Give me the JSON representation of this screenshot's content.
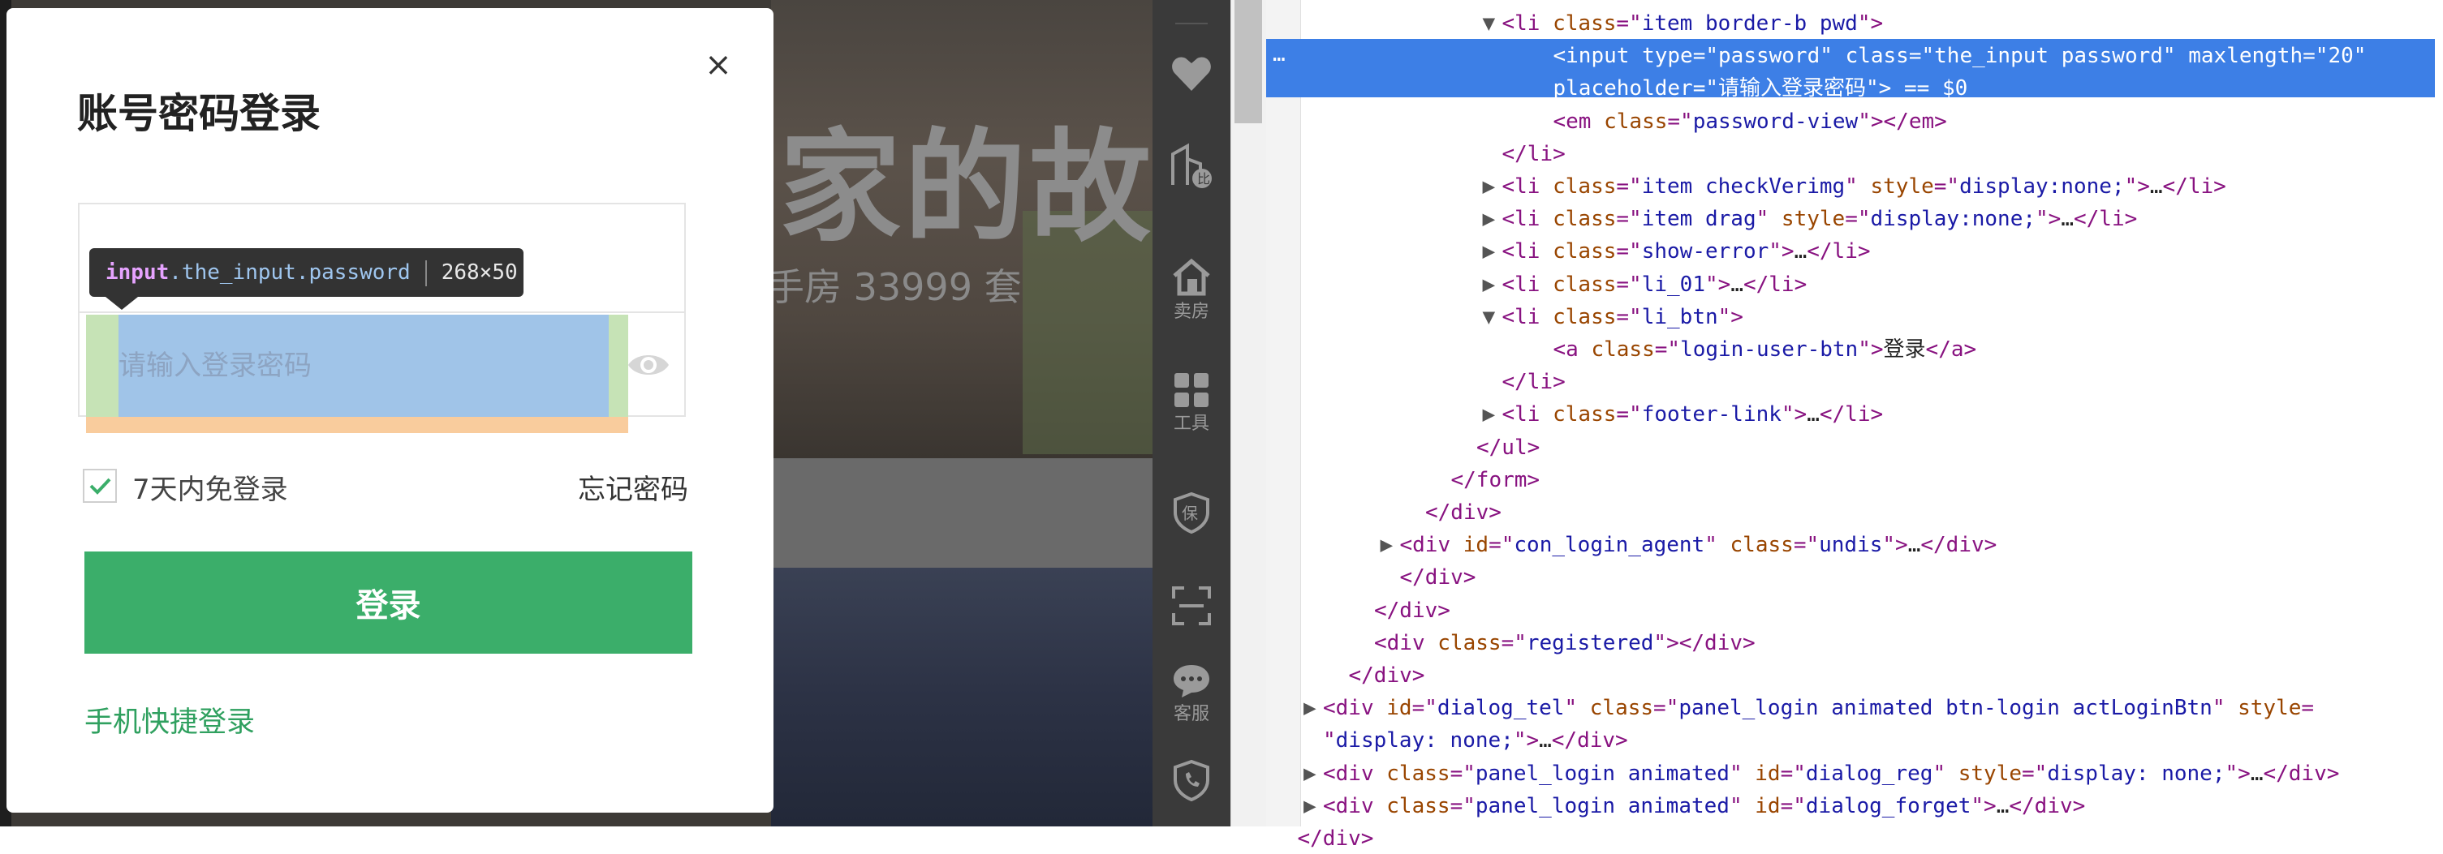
{
  "page": {
    "hero_title": "家的故事",
    "hero_subtitle": "手房 33999 套"
  },
  "toolbar": {
    "items": [
      {
        "icon": "heart-icon",
        "label": ""
      },
      {
        "icon": "building-compare-icon",
        "label": ""
      },
      {
        "icon": "house-sell-icon",
        "label": "卖房"
      },
      {
        "icon": "tools-grid-icon",
        "label": "工具"
      },
      {
        "icon": "shield-icon",
        "label": ""
      },
      {
        "icon": "scan-icon",
        "label": ""
      },
      {
        "icon": "chat-icon",
        "label": "客服"
      },
      {
        "icon": "phone-icon",
        "label": ""
      }
    ]
  },
  "dialog": {
    "title": "账号密码登录",
    "close": "×",
    "password_placeholder": "请输入登录密码",
    "remember_label": "7天内免登录",
    "remember_checked": true,
    "forgot_label": "忘记密码",
    "login_label": "登录",
    "phone_login_label": "手机快捷登录"
  },
  "inspector_tooltip": {
    "tag": "input",
    "classes": ".the_input.password",
    "size": "268×50"
  },
  "colors": {
    "primary_green": "#3bae6a",
    "link_green": "#2fa05f",
    "selection_blue": "#3d7fe6"
  },
  "devtools": {
    "lines": [
      {
        "indent": 9,
        "tri": "▼",
        "parts": [
          [
            "t",
            "<li "
          ],
          [
            "an",
            "class"
          ],
          [
            "t",
            "=\""
          ],
          [
            "av",
            "item border-b pwd"
          ],
          [
            "t",
            "\">"
          ]
        ]
      },
      {
        "indent": 11,
        "tri": "",
        "sel": true,
        "parts": [
          [
            "t",
            "<input "
          ],
          [
            "an",
            "type"
          ],
          [
            "t",
            "=\""
          ],
          [
            "av",
            "password"
          ],
          [
            "t",
            "\" "
          ],
          [
            "an",
            "class"
          ],
          [
            "t",
            "=\""
          ],
          [
            "av",
            "the_input password"
          ],
          [
            "t",
            "\" "
          ],
          [
            "an",
            "maxlength"
          ],
          [
            "t",
            "=\""
          ],
          [
            "av",
            "20"
          ],
          [
            "t",
            "\""
          ]
        ]
      },
      {
        "indent": 11,
        "tri": "",
        "sel": true,
        "parts": [
          [
            "an",
            "placeholder"
          ],
          [
            "t",
            "=\""
          ],
          [
            "av",
            "请输入登录密码"
          ],
          [
            "t",
            "\">"
          ],
          [
            "tx",
            " == $0"
          ]
        ]
      },
      {
        "indent": 11,
        "tri": "",
        "parts": [
          [
            "t",
            "<em "
          ],
          [
            "an",
            "class"
          ],
          [
            "t",
            "=\""
          ],
          [
            "av",
            "password-view"
          ],
          [
            "t",
            "\"></em>"
          ]
        ]
      },
      {
        "indent": 9,
        "tri": "",
        "parts": [
          [
            "t",
            "</li>"
          ]
        ]
      },
      {
        "indent": 9,
        "tri": "▶",
        "parts": [
          [
            "t",
            "<li "
          ],
          [
            "an",
            "class"
          ],
          [
            "t",
            "=\""
          ],
          [
            "av",
            "item checkVerimg"
          ],
          [
            "t",
            "\" "
          ],
          [
            "an",
            "style"
          ],
          [
            "t",
            "=\""
          ],
          [
            "av",
            "display:none;"
          ],
          [
            "t",
            "\">"
          ],
          [
            "tx",
            "…"
          ],
          [
            "t",
            "</li>"
          ]
        ]
      },
      {
        "indent": 9,
        "tri": "▶",
        "parts": [
          [
            "t",
            "<li "
          ],
          [
            "an",
            "class"
          ],
          [
            "t",
            "=\""
          ],
          [
            "av",
            "item drag"
          ],
          [
            "t",
            "\" "
          ],
          [
            "an",
            "style"
          ],
          [
            "t",
            "=\""
          ],
          [
            "av",
            "display:none;"
          ],
          [
            "t",
            "\">"
          ],
          [
            "tx",
            "…"
          ],
          [
            "t",
            "</li>"
          ]
        ]
      },
      {
        "indent": 9,
        "tri": "▶",
        "parts": [
          [
            "t",
            "<li "
          ],
          [
            "an",
            "class"
          ],
          [
            "t",
            "=\""
          ],
          [
            "av",
            "show-error"
          ],
          [
            "t",
            "\">"
          ],
          [
            "tx",
            "…"
          ],
          [
            "t",
            "</li>"
          ]
        ]
      },
      {
        "indent": 9,
        "tri": "▶",
        "parts": [
          [
            "t",
            "<li "
          ],
          [
            "an",
            "class"
          ],
          [
            "t",
            "=\""
          ],
          [
            "av",
            "li_01"
          ],
          [
            "t",
            "\">"
          ],
          [
            "tx",
            "…"
          ],
          [
            "t",
            "</li>"
          ]
        ]
      },
      {
        "indent": 9,
        "tri": "▼",
        "parts": [
          [
            "t",
            "<li "
          ],
          [
            "an",
            "class"
          ],
          [
            "t",
            "=\""
          ],
          [
            "av",
            "li_btn"
          ],
          [
            "t",
            "\">"
          ]
        ]
      },
      {
        "indent": 11,
        "tri": "",
        "parts": [
          [
            "t",
            "<a "
          ],
          [
            "an",
            "class"
          ],
          [
            "t",
            "=\""
          ],
          [
            "av",
            "login-user-btn"
          ],
          [
            "t",
            "\">"
          ],
          [
            "tx",
            "登录"
          ],
          [
            "t",
            "</a>"
          ]
        ]
      },
      {
        "indent": 9,
        "tri": "",
        "parts": [
          [
            "t",
            "</li>"
          ]
        ]
      },
      {
        "indent": 9,
        "tri": "▶",
        "parts": [
          [
            "t",
            "<li "
          ],
          [
            "an",
            "class"
          ],
          [
            "t",
            "=\""
          ],
          [
            "av",
            "footer-link"
          ],
          [
            "t",
            "\">"
          ],
          [
            "tx",
            "…"
          ],
          [
            "t",
            "</li>"
          ]
        ]
      },
      {
        "indent": 8,
        "tri": "",
        "parts": [
          [
            "t",
            "</ul>"
          ]
        ]
      },
      {
        "indent": 7,
        "tri": "",
        "parts": [
          [
            "t",
            "</form>"
          ]
        ]
      },
      {
        "indent": 6,
        "tri": "",
        "parts": [
          [
            "t",
            "</div>"
          ]
        ]
      },
      {
        "indent": 5,
        "tri": "▶",
        "parts": [
          [
            "t",
            "<div "
          ],
          [
            "an",
            "id"
          ],
          [
            "t",
            "=\""
          ],
          [
            "av",
            "con_login_agent"
          ],
          [
            "t",
            "\" "
          ],
          [
            "an",
            "class"
          ],
          [
            "t",
            "=\""
          ],
          [
            "av",
            "undis"
          ],
          [
            "t",
            "\">"
          ],
          [
            "tx",
            "…"
          ],
          [
            "t",
            "</div>"
          ]
        ]
      },
      {
        "indent": 5,
        "tri": "",
        "parts": [
          [
            "t",
            "</div>"
          ]
        ]
      },
      {
        "indent": 4,
        "tri": "",
        "parts": [
          [
            "t",
            "</div>"
          ]
        ]
      },
      {
        "indent": 4,
        "tri": "",
        "parts": [
          [
            "t",
            "<div "
          ],
          [
            "an",
            "class"
          ],
          [
            "t",
            "=\""
          ],
          [
            "av",
            "registered"
          ],
          [
            "t",
            "\"></div>"
          ]
        ]
      },
      {
        "indent": 3,
        "tri": "",
        "parts": [
          [
            "t",
            "</div>"
          ]
        ]
      },
      {
        "indent": 2,
        "tri": "▶",
        "parts": [
          [
            "t",
            "<div "
          ],
          [
            "an",
            "id"
          ],
          [
            "t",
            "=\""
          ],
          [
            "av",
            "dialog_tel"
          ],
          [
            "t",
            "\" "
          ],
          [
            "an",
            "class"
          ],
          [
            "t",
            "=\""
          ],
          [
            "av",
            "panel_login animated btn-login actLoginBtn"
          ],
          [
            "t",
            "\" "
          ],
          [
            "an",
            "style"
          ],
          [
            "t",
            "="
          ]
        ]
      },
      {
        "indent": 2,
        "tri": "",
        "parts": [
          [
            "t",
            "\""
          ],
          [
            "av",
            "display: none;"
          ],
          [
            "t",
            "\">"
          ],
          [
            "tx",
            "…"
          ],
          [
            "t",
            "</div>"
          ]
        ]
      },
      {
        "indent": 2,
        "tri": "▶",
        "parts": [
          [
            "t",
            "<div "
          ],
          [
            "an",
            "class"
          ],
          [
            "t",
            "=\""
          ],
          [
            "av",
            "panel_login animated"
          ],
          [
            "t",
            "\" "
          ],
          [
            "an",
            "id"
          ],
          [
            "t",
            "=\""
          ],
          [
            "av",
            "dialog_reg"
          ],
          [
            "t",
            "\" "
          ],
          [
            "an",
            "style"
          ],
          [
            "t",
            "=\""
          ],
          [
            "av",
            "display: none;"
          ],
          [
            "t",
            "\">"
          ],
          [
            "tx",
            "…"
          ],
          [
            "t",
            "</div>"
          ]
        ]
      },
      {
        "indent": 2,
        "tri": "▶",
        "parts": [
          [
            "t",
            "<div "
          ],
          [
            "an",
            "class"
          ],
          [
            "t",
            "=\""
          ],
          [
            "av",
            "panel_login animated"
          ],
          [
            "t",
            "\" "
          ],
          [
            "an",
            "id"
          ],
          [
            "t",
            "=\""
          ],
          [
            "av",
            "dialog_forget"
          ],
          [
            "t",
            "\">"
          ],
          [
            "tx",
            "…"
          ],
          [
            "t",
            "</div>"
          ]
        ]
      },
      {
        "indent": 1,
        "tri": "",
        "parts": [
          [
            "t",
            "</div>"
          ]
        ]
      }
    ]
  }
}
